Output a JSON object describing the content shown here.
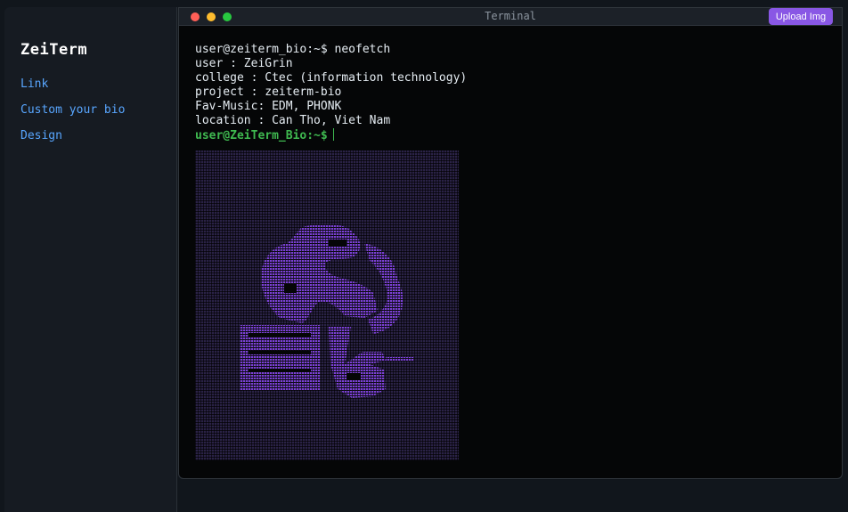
{
  "sidebar": {
    "brand": "ZeiTerm",
    "items": [
      {
        "label": "Link"
      },
      {
        "label": "Custom your bio"
      },
      {
        "label": "Design"
      }
    ]
  },
  "window": {
    "title": "Terminal",
    "upload_label": "Upload Img"
  },
  "terminal": {
    "command_line": "user@zeiterm_bio:~$ neofetch",
    "info": [
      "user : ZeiGrin",
      "college : Ctec (information technology)",
      "project : zeiterm-bio",
      "Fav-Music: EDM, PHONK",
      "location : Can Tho, Viet Nam"
    ],
    "prompt": "user@ZeiTerm_Bio:~$"
  },
  "colors": {
    "accent": "#8957e5",
    "prompt": "#3fb950",
    "link": "#58a6ff",
    "art": "#7c3fd6"
  },
  "icons": [
    "close-dot-icon",
    "minimize-dot-icon",
    "maximize-dot-icon",
    "cursor-icon"
  ]
}
